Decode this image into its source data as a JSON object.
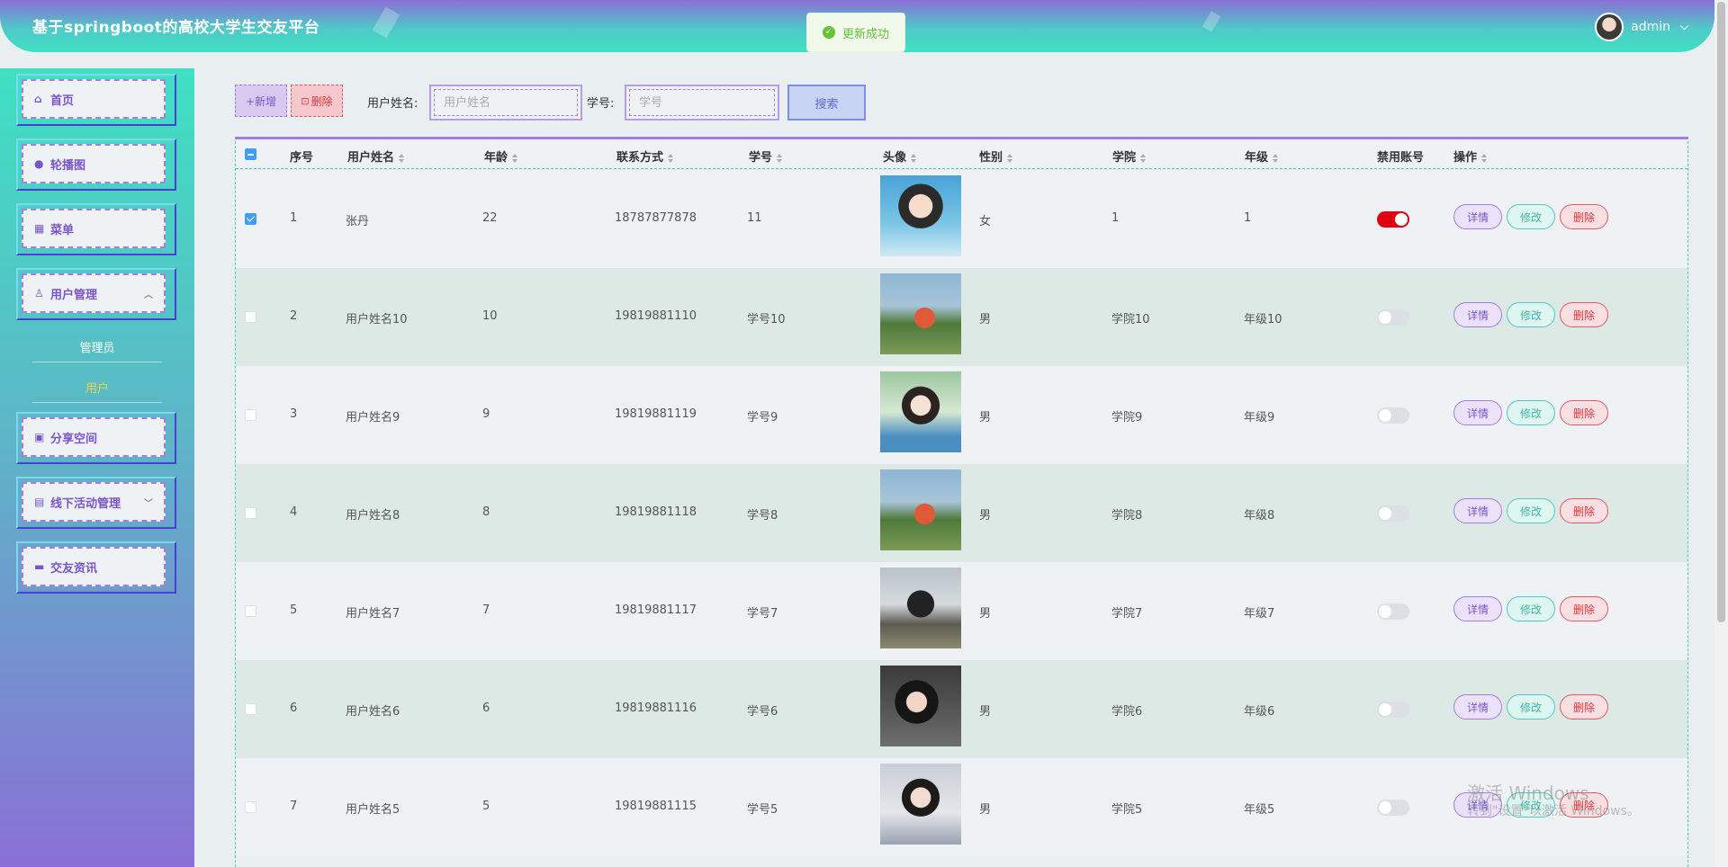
{
  "header": {
    "title": "基于springboot的高校大学生交友平台",
    "username": "admin",
    "toast": "更新成功"
  },
  "sidebar": {
    "items": [
      {
        "label": "首页",
        "icon": "home-icon",
        "glyph": "⌂"
      },
      {
        "label": "轮播图",
        "icon": "drop-icon",
        "glyph": "●"
      },
      {
        "label": "菜单",
        "icon": "grid-icon",
        "glyph": "▦"
      },
      {
        "label": "用户管理",
        "icon": "user-icon",
        "glyph": "♙",
        "expanded": true
      },
      {
        "label": "分享空间",
        "icon": "briefcase-icon",
        "glyph": "▣"
      },
      {
        "label": "线下活动管理",
        "icon": "server-icon",
        "glyph": "▤",
        "expanded": false
      },
      {
        "label": "交友资讯",
        "icon": "list-icon",
        "glyph": "▬"
      }
    ],
    "subitems": [
      {
        "label": "管理员",
        "active": false
      },
      {
        "label": "用户",
        "active": true
      }
    ]
  },
  "toolbar": {
    "add_label": "+新增",
    "delete_label": "删除",
    "name_label": "用户姓名:",
    "name_placeholder": "用户姓名",
    "name_value": "",
    "student_label": "学号:",
    "student_placeholder": "学号",
    "student_value": "",
    "search_label": "搜索"
  },
  "table": {
    "headers": [
      "序号",
      "用户姓名",
      "年龄",
      "联系方式",
      "学号",
      "头像",
      "性别",
      "学院",
      "年级",
      "禁用账号",
      "操作"
    ],
    "actions": {
      "detail": "详情",
      "edit": "修改",
      "remove": "删除"
    },
    "rows": [
      {
        "index": "1",
        "name": "张丹",
        "age": "22",
        "phone": "18787877878",
        "student_no": "11",
        "gender": "女",
        "college": "1",
        "grade": "1",
        "disabled": true,
        "checked": true
      },
      {
        "index": "2",
        "name": "用户姓名10",
        "age": "10",
        "phone": "19819881110",
        "student_no": "学号10",
        "gender": "男",
        "college": "学院10",
        "grade": "年级10",
        "disabled": false,
        "checked": false
      },
      {
        "index": "3",
        "name": "用户姓名9",
        "age": "9",
        "phone": "19819881119",
        "student_no": "学号9",
        "gender": "男",
        "college": "学院9",
        "grade": "年级9",
        "disabled": false,
        "checked": false
      },
      {
        "index": "4",
        "name": "用户姓名8",
        "age": "8",
        "phone": "19819881118",
        "student_no": "学号8",
        "gender": "男",
        "college": "学院8",
        "grade": "年级8",
        "disabled": false,
        "checked": false
      },
      {
        "index": "5",
        "name": "用户姓名7",
        "age": "7",
        "phone": "19819881117",
        "student_no": "学号7",
        "gender": "男",
        "college": "学院7",
        "grade": "年级7",
        "disabled": false,
        "checked": false
      },
      {
        "index": "6",
        "name": "用户姓名6",
        "age": "6",
        "phone": "19819881116",
        "student_no": "学号6",
        "gender": "男",
        "college": "学院6",
        "grade": "年级6",
        "disabled": false,
        "checked": false
      },
      {
        "index": "7",
        "name": "用户姓名5",
        "age": "5",
        "phone": "19819881115",
        "student_no": "学号5",
        "gender": "男",
        "college": "学院5",
        "grade": "年级5",
        "disabled": false,
        "checked": false
      }
    ]
  },
  "watermark": {
    "line1": "激活 Windows",
    "line2": "转到\"设置\"以激活 Windows。"
  },
  "colors": {
    "accent": "#a37ee0",
    "teal": "#4fc9c8",
    "danger": "#e00012"
  }
}
